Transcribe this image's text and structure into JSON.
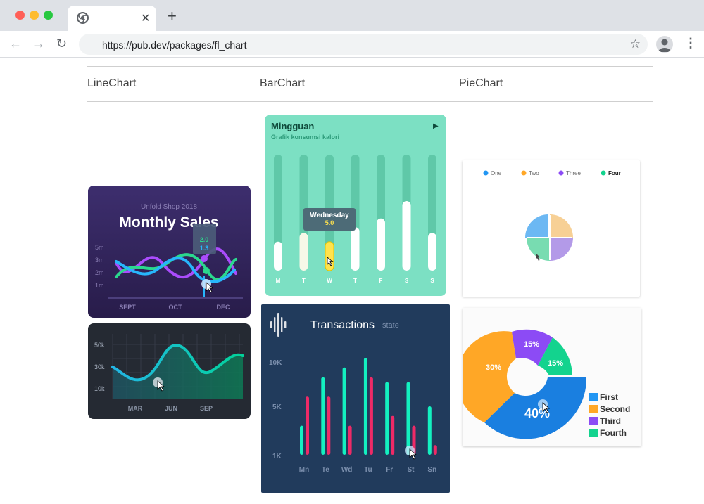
{
  "browser": {
    "url": "https://pub.dev/packages/fl_chart",
    "tab_close": "✕",
    "new_tab": "+",
    "back": "←",
    "forward": "→",
    "reload": "↻",
    "star": "☆",
    "menu": "⋮"
  },
  "page": {
    "headers": [
      "LineChart",
      "BarChart",
      "PieChart"
    ]
  },
  "monthly_sales": {
    "subtitle": "Unfold Shop 2018",
    "title": "Monthly Sales",
    "tooltip": [
      "2.0",
      "1.3"
    ],
    "y_ticks": [
      "5m",
      "3m",
      "2m",
      "1m"
    ],
    "x_ticks": [
      "SEPT",
      "OCT",
      "DEC"
    ]
  },
  "dark_line": {
    "y_ticks": [
      "50k",
      "30k",
      "10k"
    ],
    "x_ticks": [
      "MAR",
      "JUN",
      "SEP"
    ]
  },
  "mingguan": {
    "title": "Mingguan",
    "subtitle": "Grafik konsumsi kalori",
    "play": "▶",
    "days": [
      "M",
      "T",
      "W",
      "T",
      "F",
      "S",
      "S"
    ],
    "tooltip_day": "Wednesday",
    "tooltip_value": "5.0"
  },
  "transactions": {
    "title": "Transactions",
    "subtitle": "state",
    "y_ticks": [
      "10K",
      "5K",
      "1K"
    ],
    "days": [
      "Mn",
      "Te",
      "Wd",
      "Tu",
      "Fr",
      "St",
      "Sn"
    ]
  },
  "pie_small": {
    "legend": [
      "One",
      "Two",
      "Three",
      "Four"
    ]
  },
  "donut": {
    "labels": [
      "15%",
      "15%",
      "30%",
      "40%"
    ],
    "legend": [
      "First",
      "Second",
      "Third",
      "Fourth"
    ]
  },
  "colors": {
    "blue": "#2196F3",
    "orange": "#FFA726",
    "purple": "#8C4BF5",
    "green": "#13D38E",
    "teal": "#7CE0C3",
    "navy": "#213b5c"
  },
  "chart_data": [
    {
      "type": "bar",
      "title": "Mingguan",
      "subtitle": "Grafik konsumsi kalori",
      "categories": [
        "M",
        "T",
        "W",
        "T",
        "F",
        "S",
        "S"
      ],
      "values": [
        5,
        6.5,
        5,
        7.5,
        9,
        12,
        6.5
      ],
      "ylim": [
        0,
        20
      ]
    },
    {
      "type": "bar",
      "title": "Transactions",
      "categories": [
        "Mn",
        "Te",
        "Wd",
        "Tu",
        "Fr",
        "St",
        "Sn"
      ],
      "series": [
        {
          "values": [
            3,
            8,
            9,
            10,
            7.5,
            7.5,
            5
          ]
        },
        {
          "values": [
            6,
            6,
            3,
            8,
            4,
            3,
            1
          ]
        }
      ],
      "ylim": [
        0,
        10
      ]
    },
    {
      "type": "pie",
      "categories": [
        "One",
        "Two",
        "Three",
        "Four"
      ],
      "values": [
        25,
        25,
        25,
        25
      ]
    },
    {
      "type": "pie",
      "categories": [
        "First",
        "Second",
        "Third",
        "Fourth"
      ],
      "values": [
        40,
        30,
        15,
        15
      ]
    }
  ]
}
